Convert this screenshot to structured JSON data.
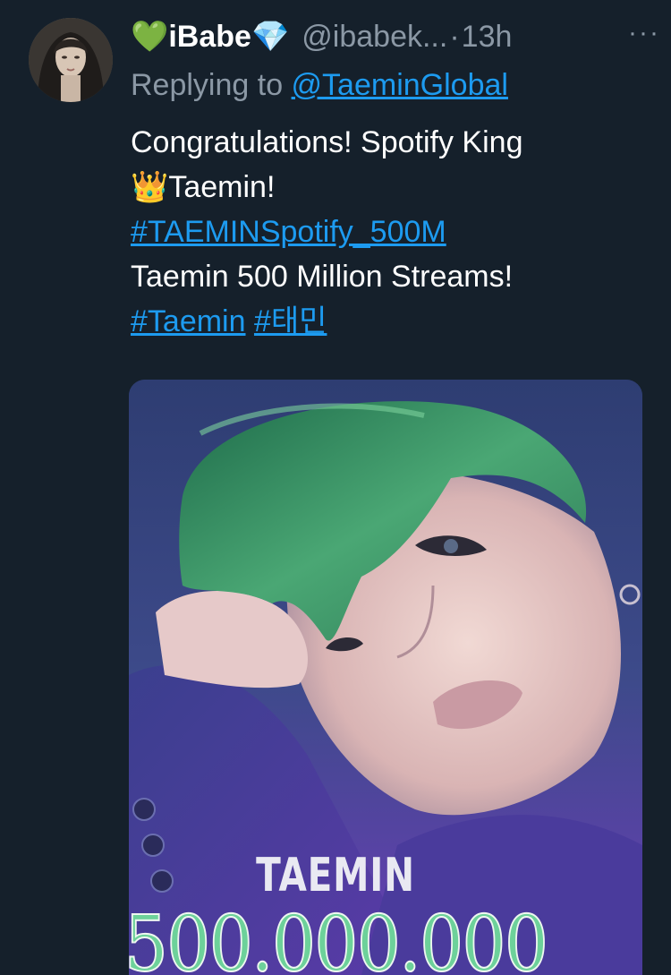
{
  "tweet": {
    "author": {
      "display_name": "iBabe",
      "prefix_emoji": "💚",
      "suffix_emoji": "💎",
      "handle": "@ibabek...",
      "separator": "·",
      "time": "13h",
      "avatar_icon": "user-avatar"
    },
    "more_label": "···",
    "reply": {
      "prefix": "Replying to ",
      "target": "@TaeminGlobal"
    },
    "body": {
      "line1": "Congratulations! Spotify King",
      "crown_emoji": "👑",
      "line2": "Taemin!",
      "hashtag1": "#TAEMINSpotify_500M",
      "line3": "Taemin 500 Million Streams!",
      "hashtag2": "#Taemin",
      "hashtag3": "#태민"
    },
    "media": {
      "caption_name": "TAEMIN",
      "caption_count": "500.000.000"
    }
  },
  "colors": {
    "background": "#15202b",
    "link": "#1d9bf0",
    "muted": "#8b98a5",
    "count_green": "#6dd19a"
  }
}
